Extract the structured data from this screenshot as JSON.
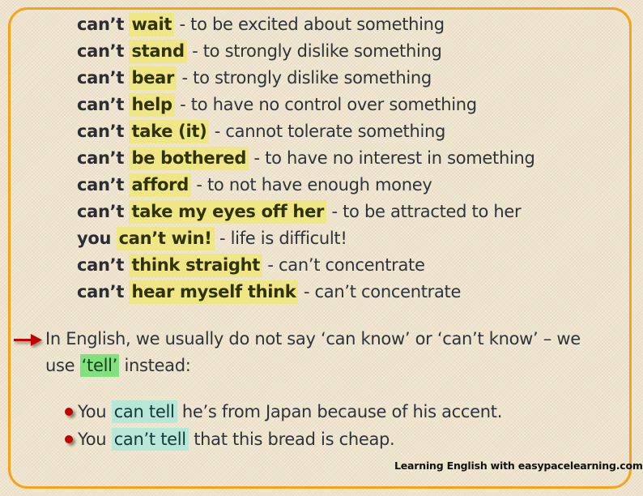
{
  "idioms": [
    {
      "prefix": "can’t",
      "phrase": "wait",
      "definition": "- to be excited about something"
    },
    {
      "prefix": "can’t",
      "phrase": "stand",
      "definition": "- to strongly dislike something"
    },
    {
      "prefix": "can’t",
      "phrase": "bear",
      "definition": "- to strongly dislike something"
    },
    {
      "prefix": "can’t",
      "phrase": "help",
      "definition": "- to have no control over something"
    },
    {
      "prefix": "can’t",
      "phrase": "take (it)",
      "definition": "- cannot tolerate something"
    },
    {
      "prefix": "can’t",
      "phrase": "be bothered",
      "definition": "- to have no interest in something"
    },
    {
      "prefix": "can’t",
      "phrase": "afford",
      "definition": "- to not have enough money"
    },
    {
      "prefix": "can’t",
      "phrase": "take my eyes off her",
      "definition": "- to be attracted to her"
    },
    {
      "prefix": "you",
      "phrase": "can’t win!",
      "definition": "- life is difficult!"
    },
    {
      "prefix": "can’t",
      "phrase": "think straight",
      "definition": "- can’t concentrate"
    },
    {
      "prefix": "can’t",
      "phrase": "hear myself think",
      "definition": "- can’t concentrate"
    }
  ],
  "note": {
    "icon": "arrow-right-icon",
    "line1": "In English, we usually do not say ‘can know’ or ‘can’t know’ – we",
    "line2_before": "use",
    "line2_highlight": "‘tell’",
    "line2_after": "instead:"
  },
  "examples": [
    {
      "before": "You",
      "highlight": "can tell",
      "after": "he’s from Japan because of his accent."
    },
    {
      "before": "You",
      "highlight": "can’t tell",
      "after": "that this bread is cheap."
    }
  ],
  "credit": "Learning English with easypacelearning.com",
  "colors": {
    "frame": "#f7a21b",
    "highlight_yellow": "#efe685",
    "highlight_green": "#7fe27f",
    "highlight_teal": "#b7e7d6",
    "bullet_red": "#c00000",
    "arrow_red": "#c00000"
  }
}
